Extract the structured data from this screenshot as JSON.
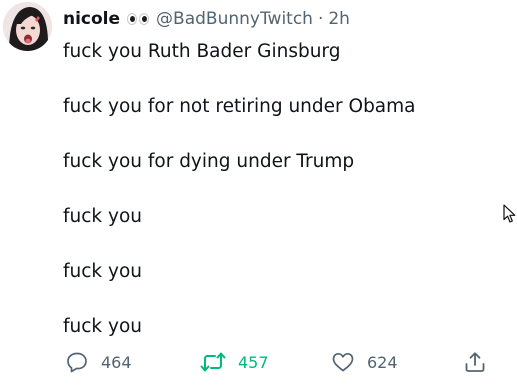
{
  "tweet": {
    "display_name": "nicole",
    "handle": "@BadBunnyTwitch",
    "separator": "·",
    "time": "2h",
    "lines": [
      "fuck you Ruth Bader Ginsburg",
      "fuck you for not retiring under Obama",
      "fuck you for dying under Trump",
      "fuck you",
      "fuck you",
      "fuck you"
    ]
  },
  "actions": {
    "reply_count": "464",
    "retweet_count": "457",
    "like_count": "624"
  },
  "icons": {
    "reply": "reply-icon",
    "retweet": "retweet-icon",
    "like": "heart-icon",
    "share": "share-icon",
    "emoji": "eyes-emoji-icon"
  },
  "colors": {
    "text": "#0f1419",
    "muted": "#536471",
    "retweet_active": "#00ba7c"
  }
}
